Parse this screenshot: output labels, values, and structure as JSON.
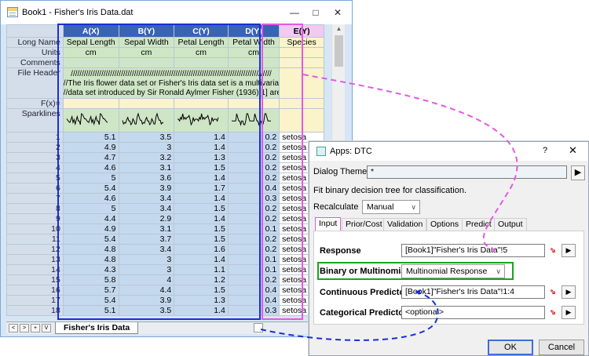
{
  "book": {
    "title": "Book1 - Fisher's Iris Data.dat",
    "columns": [
      {
        "name": "A(X)",
        "long_name": "Sepal Length",
        "units": "cm"
      },
      {
        "name": "B(Y)",
        "long_name": "Sepal Width",
        "units": "cm"
      },
      {
        "name": "C(Y)",
        "long_name": "Petal Length",
        "units": "cm"
      },
      {
        "name": "D(Y)",
        "long_name": "Petal Width",
        "units": "cm"
      },
      {
        "name": "E(Y)",
        "long_name": "Species",
        "units": ""
      }
    ],
    "row_labels": {
      "long_name": "Long Name",
      "units": "Units",
      "comments": "Comments",
      "file_header": "File Header",
      "fx": "F(x)=",
      "sparklines": "Sparklines"
    },
    "file_header_lines": [
      "////////////////////////////////////////////////////////////////////////////////////////////",
      "//The Iris flower data set or Fisher's Iris data set is a multivariate",
      "//data set introduced by Sir Ronald Aylmer Fisher (1936)[1] are"
    ],
    "rows": [
      [
        "1",
        "5.1",
        "3.5",
        "1.4",
        "0.2",
        "setosa"
      ],
      [
        "2",
        "4.9",
        "3",
        "1.4",
        "0.2",
        "setosa"
      ],
      [
        "3",
        "4.7",
        "3.2",
        "1.3",
        "0.2",
        "setosa"
      ],
      [
        "4",
        "4.6",
        "3.1",
        "1.5",
        "0.2",
        "setosa"
      ],
      [
        "5",
        "5",
        "3.6",
        "1.4",
        "0.2",
        "setosa"
      ],
      [
        "6",
        "5.4",
        "3.9",
        "1.7",
        "0.4",
        "setosa"
      ],
      [
        "7",
        "4.6",
        "3.4",
        "1.4",
        "0.3",
        "setosa"
      ],
      [
        "8",
        "5",
        "3.4",
        "1.5",
        "0.2",
        "setosa"
      ],
      [
        "9",
        "4.4",
        "2.9",
        "1.4",
        "0.2",
        "setosa"
      ],
      [
        "10",
        "4.9",
        "3.1",
        "1.5",
        "0.1",
        "setosa"
      ],
      [
        "11",
        "5.4",
        "3.7",
        "1.5",
        "0.2",
        "setosa"
      ],
      [
        "12",
        "4.8",
        "3.4",
        "1.6",
        "0.2",
        "setosa"
      ],
      [
        "13",
        "4.8",
        "3",
        "1.4",
        "0.1",
        "setosa"
      ],
      [
        "14",
        "4.3",
        "3",
        "1.1",
        "0.1",
        "setosa"
      ],
      [
        "15",
        "5.8",
        "4",
        "1.2",
        "0.2",
        "setosa"
      ],
      [
        "16",
        "5.7",
        "4.4",
        "1.5",
        "0.4",
        "setosa"
      ],
      [
        "17",
        "5.4",
        "3.9",
        "1.3",
        "0.4",
        "setosa"
      ],
      [
        "18",
        "5.1",
        "3.5",
        "1.4",
        "0.3",
        "setosa"
      ]
    ],
    "sheet_tab": "Fisher's Iris Data",
    "nav_buttons": [
      "<",
      ">",
      "+",
      "V"
    ]
  },
  "dialog": {
    "title": "Apps: DTC",
    "help": "?",
    "close": "✕",
    "theme_label": "Dialog Theme",
    "theme_value": "*",
    "description": "Fit binary decision tree for classification.",
    "recalculate_label": "Recalculate",
    "recalculate_value": "Manual",
    "tabs": [
      "Input",
      "Prior/Cost",
      "Validation",
      "Options",
      "Predict",
      "Output"
    ],
    "response_label": "Response",
    "response_value": "[Book1]\"Fisher's Iris Data\"!5",
    "binary_label": "Binary or Multinomial",
    "binary_value": "Multinomial Response",
    "continuous_label": "Continuous Predictors",
    "continuous_value": "[Book1]\"Fisher's Iris Data\"!1:4",
    "categorical_label": "Categorical Predictors",
    "categorical_value": "<optional>",
    "ok": "OK",
    "cancel": "Cancel"
  },
  "colors": {
    "selection_blue": "#1a2fd6",
    "selection_pink": "#e25ae2",
    "binary_highlight": "#17a51c"
  }
}
